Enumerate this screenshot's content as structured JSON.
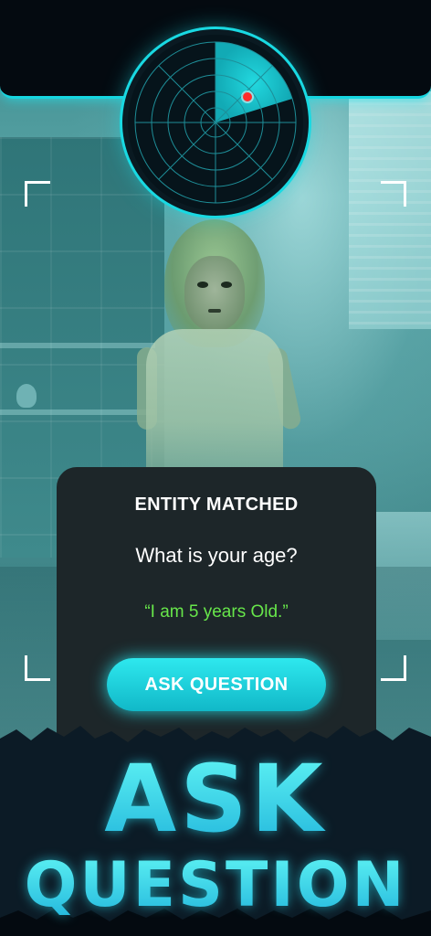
{
  "card": {
    "title": "ENTITY MATCHED",
    "question": "What is your age?",
    "answer": "“I am 5 years Old.”",
    "button_label": "ASK QUESTION"
  },
  "banner": {
    "line1": "ASK",
    "line2": "QUESTION"
  },
  "colors": {
    "accent": "#19d9e2",
    "answer_green": "#67e64a",
    "card_bg": "#1d2629",
    "radar_blip": "#ff2a2a"
  },
  "icons": [
    "radar-icon",
    "radar-blip-icon",
    "corner-bracket-icon"
  ]
}
